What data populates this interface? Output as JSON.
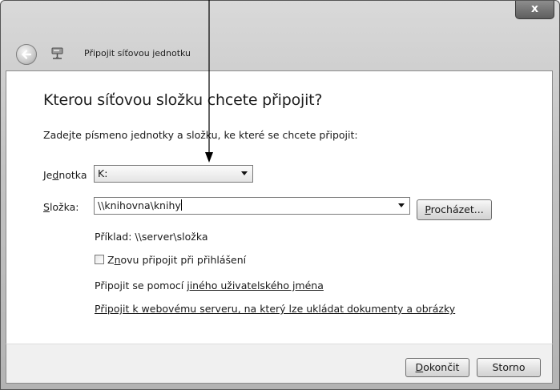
{
  "window": {
    "title": "Připojit síťovou jednotku",
    "close_label": "x"
  },
  "main": {
    "heading": "Kterou síťovou složku chcete připojit?",
    "instruction": "Zadejte písmeno jednotky a složku, ke které se chcete připojit:",
    "drive": {
      "label_pre": "Je",
      "label_key": "d",
      "label_post": "notka",
      "value": "K:"
    },
    "folder": {
      "label_key": "S",
      "label_post": "ložka:",
      "value": "\\\\knihovna\\knihy"
    },
    "browse": {
      "label_key": "P",
      "label_post": "rocházet..."
    },
    "example": "Příklad: \\\\server\\složka",
    "reconnect": {
      "label_pre": "Z",
      "label_key": "n",
      "label_post": "ovu připojit při přihlášení",
      "checked": false
    },
    "other_user": {
      "prefix": "Připojit se pomocí ",
      "link": "jiného uživatelského jména"
    },
    "web_link": "Připojit k webovému serveru, na který lze ukládat dokumenty a obrázky"
  },
  "footer": {
    "finish": {
      "label_key": "D",
      "label_post": "okončit"
    },
    "cancel": "Storno"
  },
  "colors": {
    "frame": "#c4c4c4",
    "content_bg": "#ffffff",
    "footer_bg": "#f0f0f0"
  },
  "icons": [
    "back-arrow-icon",
    "network-drive-icon",
    "close-icon",
    "chevron-down-icon"
  ]
}
